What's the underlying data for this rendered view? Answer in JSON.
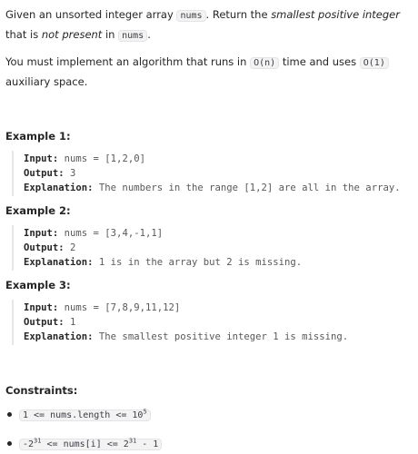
{
  "description": {
    "p1_a": "Given an unsorted integer array ",
    "p1_code1": "nums",
    "p1_b": ". Return the ",
    "p1_em1": "smallest positive integer",
    "p1_c": " that is ",
    "p1_em2": "not present",
    "p1_d": " in ",
    "p1_code2": "nums",
    "p1_e": ".",
    "p2_a": "You must implement an algorithm that runs in ",
    "p2_code1": "O(n)",
    "p2_b": " time and uses ",
    "p2_code2": "O(1)",
    "p2_c": " auxiliary space."
  },
  "examples": [
    {
      "title": "Example 1:",
      "input_label": "Input:",
      "input": " nums = [1,2,0]",
      "output_label": "Output:",
      "output": " 3",
      "explanation_label": "Explanation:",
      "explanation": " The numbers in the range [1,2] are all in the array."
    },
    {
      "title": "Example 2:",
      "input_label": "Input:",
      "input": " nums = [3,4,-1,1]",
      "output_label": "Output:",
      "output": " 2",
      "explanation_label": "Explanation:",
      "explanation": " 1 is in the array but 2 is missing."
    },
    {
      "title": "Example 3:",
      "input_label": "Input:",
      "input": " nums = [7,8,9,11,12]",
      "output_label": "Output:",
      "output": " 1",
      "explanation_label": "Explanation:",
      "explanation": " The smallest positive integer 1 is missing."
    }
  ],
  "constraints": {
    "title": "Constraints:",
    "c1_a": "1 <= nums.length <= 10",
    "c1_sup": "5",
    "c2_a": "-2",
    "c2_sup1": "31",
    "c2_b": " <= nums[i] <= 2",
    "c2_sup2": "31",
    "c2_c": " - 1"
  }
}
